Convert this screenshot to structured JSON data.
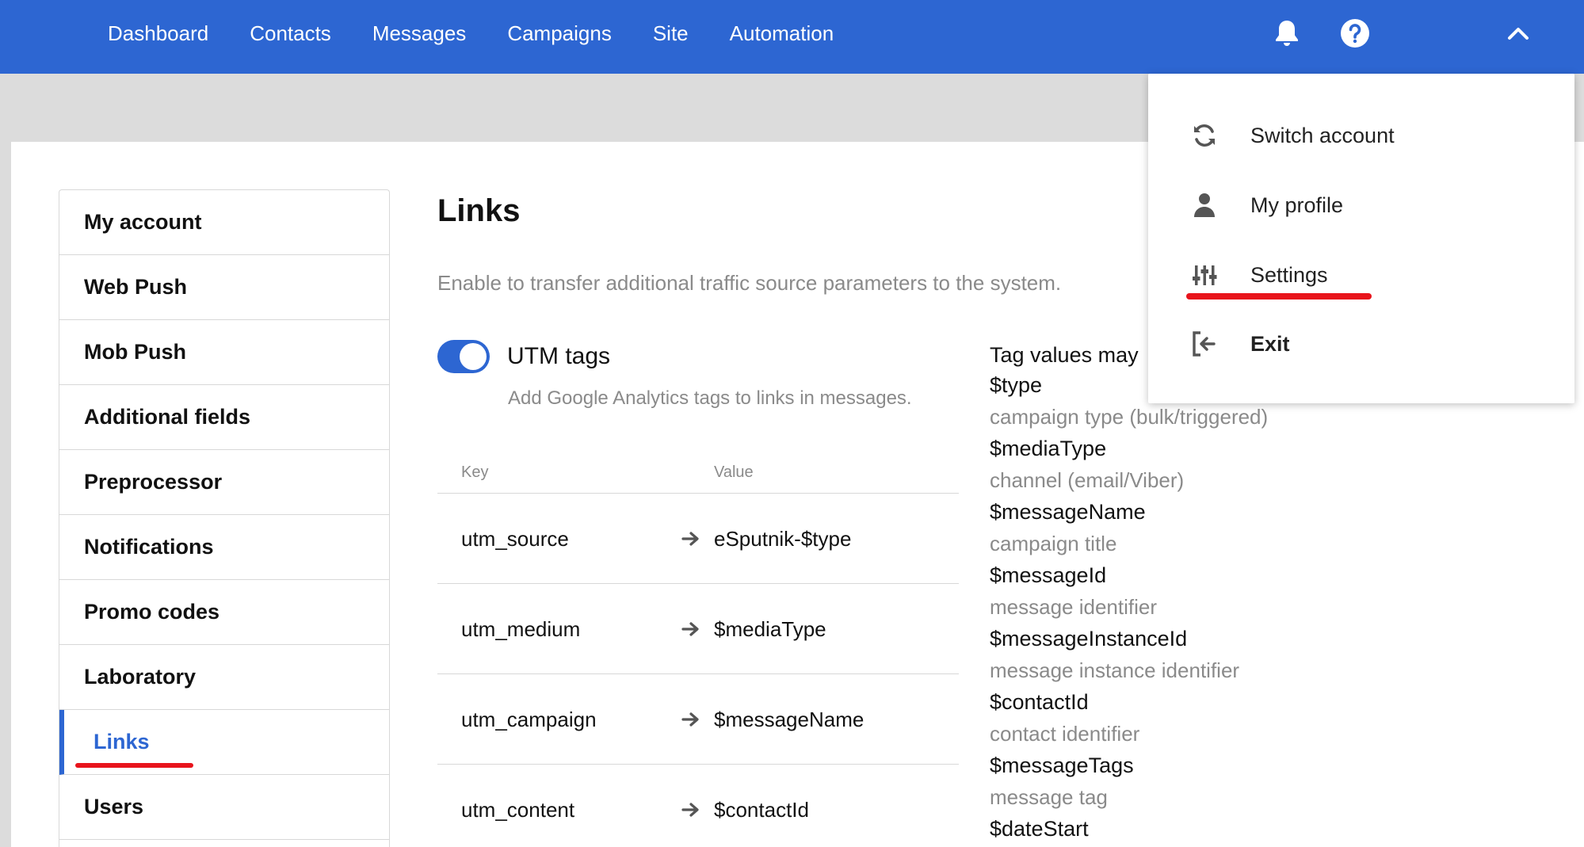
{
  "topbar": {
    "bg_color": "#2d66d2",
    "nav": [
      "Dashboard",
      "Contacts",
      "Messages",
      "Campaigns",
      "Site",
      "Automation"
    ],
    "icons": [
      "bell-icon",
      "help-icon",
      "chevron-up-icon"
    ]
  },
  "sidebar": {
    "items": [
      {
        "label": "My account"
      },
      {
        "label": "Web Push"
      },
      {
        "label": "Mob Push"
      },
      {
        "label": "Additional fields"
      },
      {
        "label": "Preprocessor"
      },
      {
        "label": "Notifications"
      },
      {
        "label": "Promo codes"
      },
      {
        "label": "Laboratory"
      },
      {
        "label": "Links",
        "active": true
      },
      {
        "label": "Users"
      }
    ]
  },
  "main": {
    "title": "Links",
    "description": "Enable to transfer additional traffic source parameters to the system.",
    "utm": {
      "label": "UTM tags",
      "enabled": true,
      "subtitle": "Add Google Analytics tags to links in messages."
    },
    "table": {
      "key_header": "Key",
      "value_header": "Value",
      "rows": [
        {
          "key": "utm_source",
          "value": "eSputnik-$type"
        },
        {
          "key": "utm_medium",
          "value": "$mediaType"
        },
        {
          "key": "utm_campaign",
          "value": "$messageName"
        },
        {
          "key": "utm_content",
          "value": "$contactId"
        }
      ]
    },
    "variables": {
      "intro": "Tag values may",
      "items": [
        {
          "name": "$type",
          "desc": "campaign type (bulk/triggered)"
        },
        {
          "name": "$mediaType",
          "desc": "channel (email/Viber)"
        },
        {
          "name": "$messageName",
          "desc": "campaign title"
        },
        {
          "name": "$messageId",
          "desc": "message identifier"
        },
        {
          "name": "$messageInstanceId",
          "desc": "message instance identifier"
        },
        {
          "name": "$contactId",
          "desc": "contact identifier"
        },
        {
          "name": "$messageTags",
          "desc": "message tag"
        },
        {
          "name": "$dateStart",
          "desc": ""
        }
      ]
    }
  },
  "dropdown": {
    "items": [
      {
        "label": "Switch account",
        "icon": "refresh-icon"
      },
      {
        "label": "My profile",
        "icon": "user-icon"
      },
      {
        "label": "Settings",
        "icon": "sliders-icon"
      },
      {
        "label": "Exit",
        "icon": "exit-icon"
      }
    ]
  },
  "colors": {
    "accent": "#2d66d2",
    "highlight_underline": "#e8141c",
    "muted_text": "#8a8a8a"
  }
}
